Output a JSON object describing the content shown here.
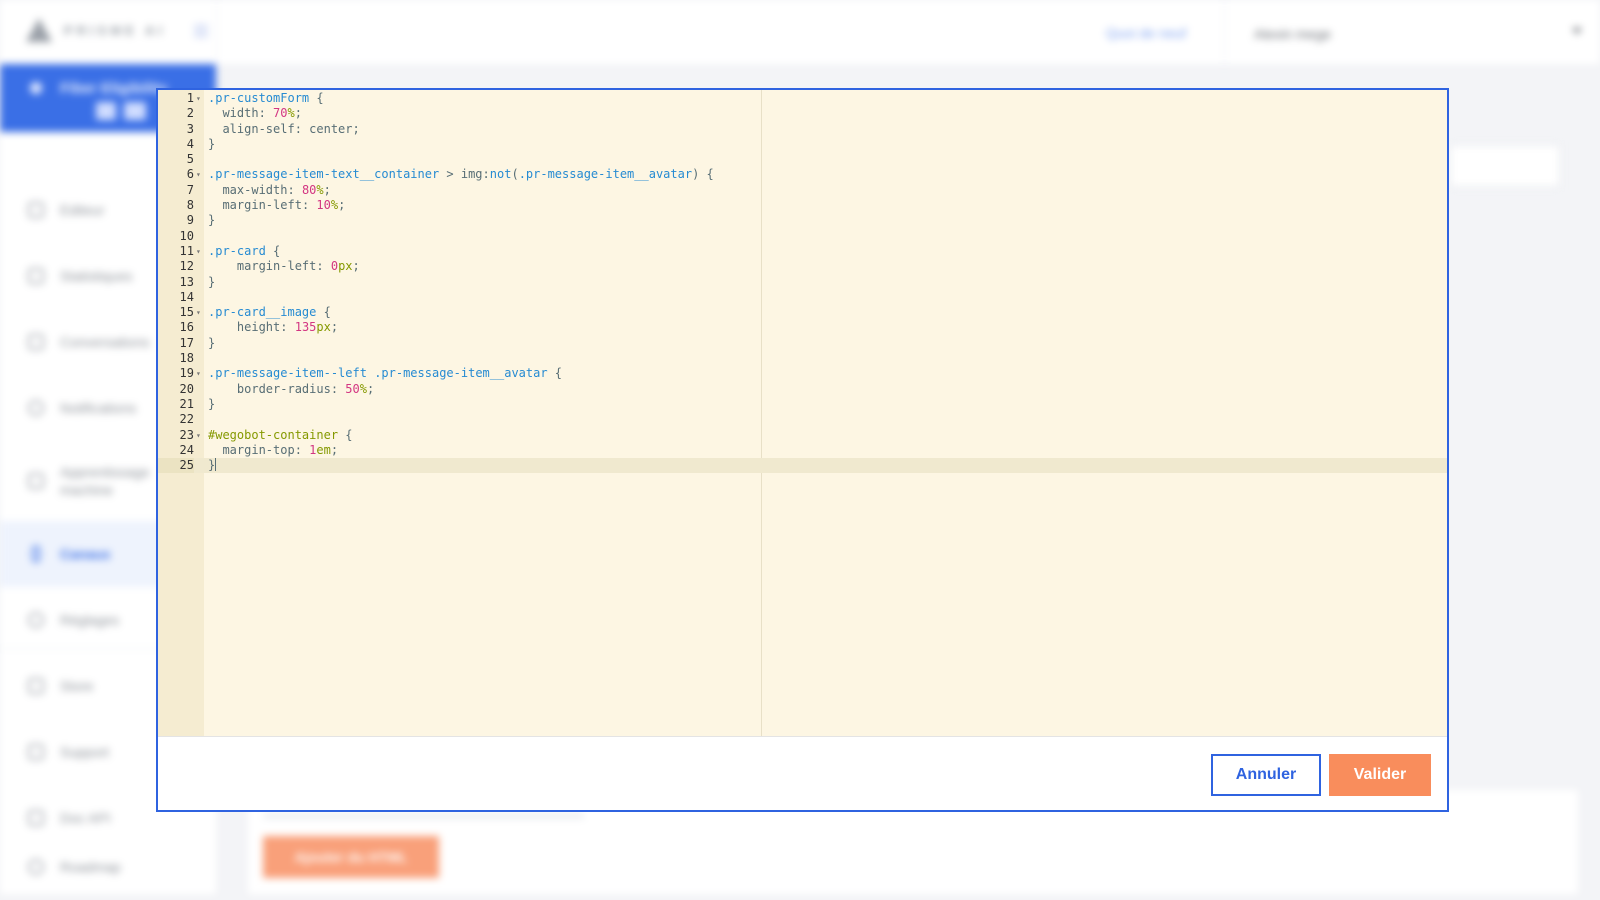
{
  "app": {
    "logo_text": "PRISME AI",
    "whats_new": "Quoi de neuf",
    "user_name": "Alexin mege",
    "project_name": "Fiber Eligibility"
  },
  "sidebar": {
    "items": [
      {
        "label": "Editeur",
        "icon": "edit-icon"
      },
      {
        "label": "Statistiques",
        "icon": "chart-icon"
      },
      {
        "label": "Conversations",
        "icon": "chat-icon"
      },
      {
        "label": "Notifications",
        "icon": "bell-icon"
      },
      {
        "label": "Apprentissage machine",
        "icon": "monitor-icon"
      },
      {
        "label": "Canaux",
        "icon": "channel-icon"
      },
      {
        "label": "Réglages",
        "icon": "gear-icon"
      },
      {
        "label": "Store",
        "icon": "store-icon"
      },
      {
        "label": "Support",
        "icon": "support-icon"
      },
      {
        "label": "Doc API",
        "icon": "doc-icon"
      },
      {
        "label": "Roadmap",
        "icon": "roadmap-icon"
      }
    ],
    "active_index": 5
  },
  "content": {
    "add_html_button": "Ajouter du HTML"
  },
  "editor": {
    "language": "css",
    "current_line": 25,
    "lines": [
      ".pr-customForm {",
      "  width: 70%;",
      "  align-self: center;",
      "}",
      "",
      ".pr-message-item-text__container > img:not(.pr-message-item__avatar) {",
      "  max-width: 80%;",
      "  margin-left: 10%;",
      "}",
      "",
      ".pr-card {",
      "    margin-left: 0px;",
      "}",
      "",
      ".pr-card__image {",
      "    height: 135px;",
      "}",
      "",
      ".pr-message-item--left .pr-message-item__avatar {",
      "    border-radius: 50%;",
      "}",
      "",
      "#wegobot-container {",
      "  margin-top: 1em;",
      "}"
    ]
  },
  "modal": {
    "cancel_label": "Annuler",
    "validate_label": "Valider",
    "colors": {
      "border": "#2f63e0",
      "validate_bg": "#f98d5c",
      "editor_bg": "#fdf6e3"
    }
  }
}
